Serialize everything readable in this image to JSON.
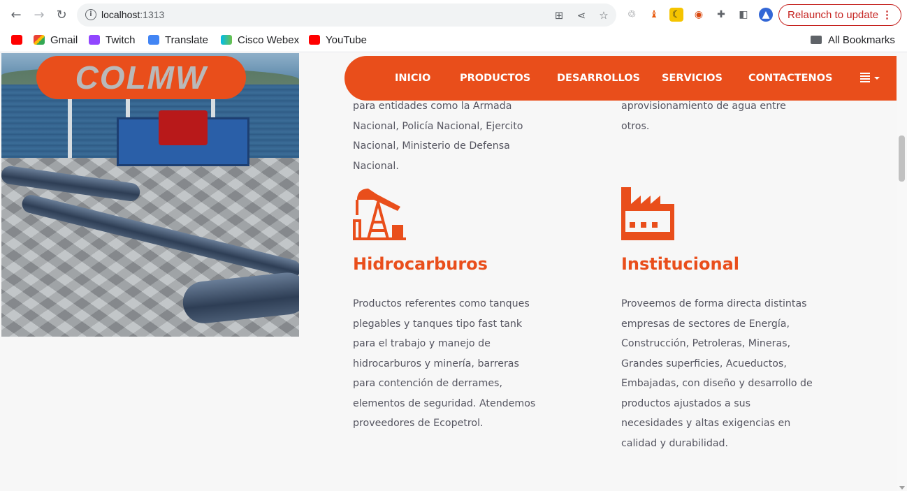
{
  "browser": {
    "url_host": "localhost",
    "url_port": ":1313",
    "relaunch_label": "Relaunch to update",
    "relaunch_menu": "⋮",
    "bookmarks": [
      {
        "label": "",
        "icon": "youtube-icon"
      },
      {
        "label": "Gmail",
        "icon": "gmail-icon"
      },
      {
        "label": "Twitch",
        "icon": "twitch-icon"
      },
      {
        "label": "Translate",
        "icon": "translate-icon"
      },
      {
        "label": "Cisco Webex",
        "icon": "webex-icon"
      },
      {
        "label": "YouTube",
        "icon": "youtube-icon"
      }
    ],
    "all_bookmarks": "All Bookmarks"
  },
  "site": {
    "logo_text": "COLMW",
    "nav": [
      "INICIO",
      "PRODUCTOS",
      "DESARROLLOS",
      "SERVICIOS",
      "CONTACTENOS"
    ],
    "accent_color": "#e94e1b"
  },
  "content": {
    "left_top_text": [
      "para entidades como la Armada",
      "Nacional, Policía Nacional, Ejercito",
      "Nacional, Ministerio de Defensa",
      "Nacional."
    ],
    "right_top_text": [
      "aprovisionamiento de agua entre",
      "otros."
    ],
    "sections": [
      {
        "icon": "oil-pump-icon",
        "title": "Hidrocarburos",
        "lines": [
          "Productos referentes como tanques",
          "plegables y tanques tipo fast tank",
          "para el trabajo y manejo de",
          "hidrocarburos y minería, barreras",
          "para contención de derrames,",
          "elementos de seguridad. Atendemos",
          "proveedores de Ecopetrol."
        ]
      },
      {
        "icon": "factory-icon",
        "title": "Institucional",
        "lines": [
          "Proveemos de forma directa distintas",
          "empresas de sectores de Energía,",
          "Construcción, Petroleras, Mineras,",
          "Grandes superficies, Acueductos,",
          "Embajadas, con diseño y desarrollo de",
          "productos ajustados a sus",
          "necesidades y altas exigencias en",
          "calidad y durabilidad."
        ]
      }
    ]
  }
}
